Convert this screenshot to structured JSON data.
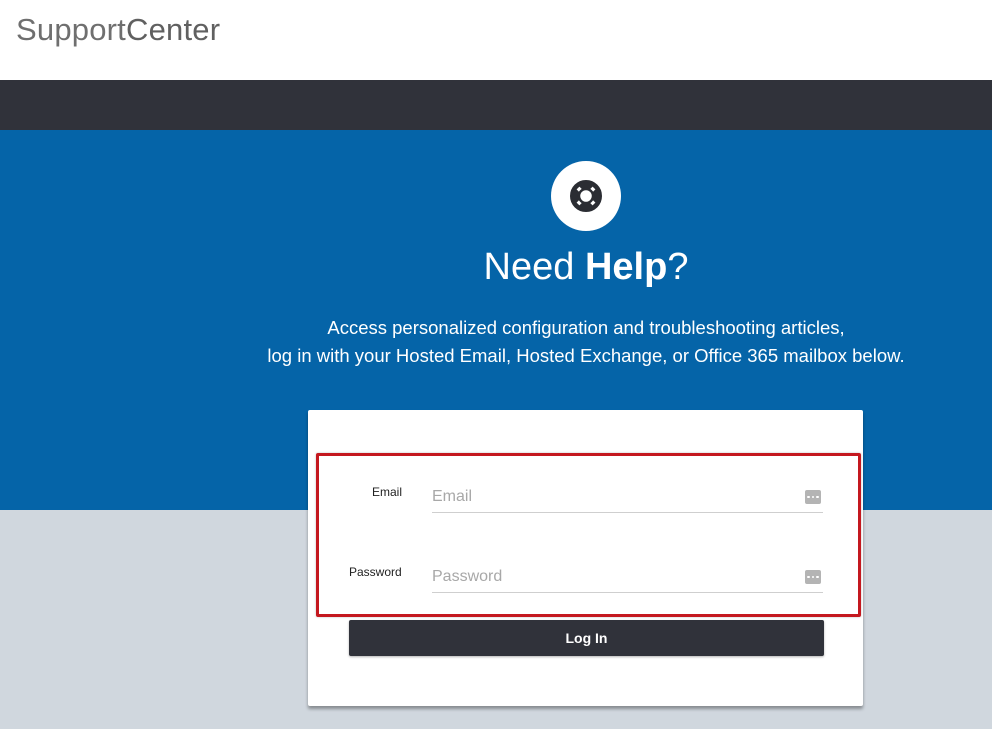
{
  "header": {
    "logo_light": "Support",
    "logo_bold": "Center"
  },
  "hero": {
    "icon": "lifebuoy-icon",
    "headline_light": "Need",
    "headline_bold": "Help",
    "headline_punct": "?",
    "subtext_line1": "Access personalized configuration and troubleshooting articles,",
    "subtext_line2": "log in with your Hosted Email, Hosted Exchange, or Office 365 mailbox below."
  },
  "login_form": {
    "email_label": "Email",
    "email_placeholder": "Email",
    "email_value": "",
    "password_label": "Password",
    "password_placeholder": "Password",
    "password_value": "",
    "field_icon": "password-manager-icon",
    "submit_label": "Log In"
  },
  "colors": {
    "hero_bg": "#0564a8",
    "nav_bg": "#30323a",
    "page_bg": "#d0d7de",
    "highlight_border": "#c4181f"
  }
}
